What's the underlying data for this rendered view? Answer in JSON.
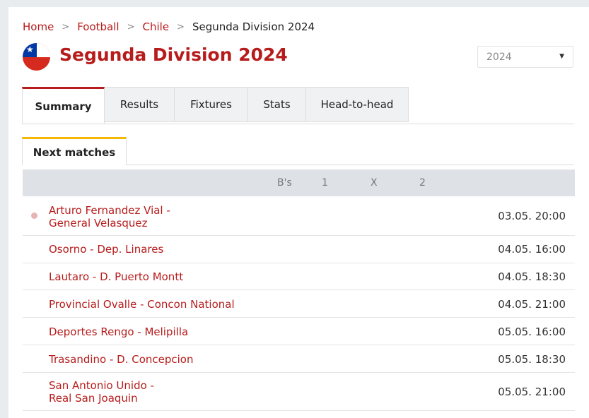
{
  "breadcrumb": {
    "home": "Home",
    "sport": "Football",
    "country": "Chile",
    "current": "Segunda Division 2024",
    "separator": ">"
  },
  "header": {
    "title": "Segunda Division 2024",
    "flag_icon": "chile-flag-icon"
  },
  "season_select": {
    "value": "2024",
    "caret": "▼"
  },
  "tabs": [
    {
      "label": "Summary",
      "active": true
    },
    {
      "label": "Results",
      "active": false
    },
    {
      "label": "Fixtures",
      "active": false
    },
    {
      "label": "Stats",
      "active": false
    },
    {
      "label": "Head-to-head",
      "active": false
    }
  ],
  "subtab": {
    "label": "Next matches"
  },
  "columns": {
    "bs": "B's",
    "one": "1",
    "x": "X",
    "two": "2"
  },
  "matches": [
    {
      "home": "Arturo Fernandez Vial -",
      "away": "General Velasquez",
      "time": "03.05. 20:00"
    },
    {
      "teams": "Osorno - Dep. Linares",
      "time": "04.05. 16:00"
    },
    {
      "teams": "Lautaro - D. Puerto Montt",
      "time": "04.05. 18:30"
    },
    {
      "teams": "Provincial Ovalle - Concon National",
      "time": "04.05. 21:00"
    },
    {
      "teams": "Deportes Rengo - Melipilla",
      "time": "05.05. 16:00"
    },
    {
      "teams": "Trasandino - D. Concepcion",
      "time": "05.05. 18:30"
    },
    {
      "home": "San Antonio Unido -",
      "away": "Real San Joaquin",
      "time": "05.05. 21:00"
    }
  ],
  "colors": {
    "brand_red": "#b71c1c",
    "accent_yellow": "#f5b800",
    "header_gray": "#dee2e6"
  }
}
